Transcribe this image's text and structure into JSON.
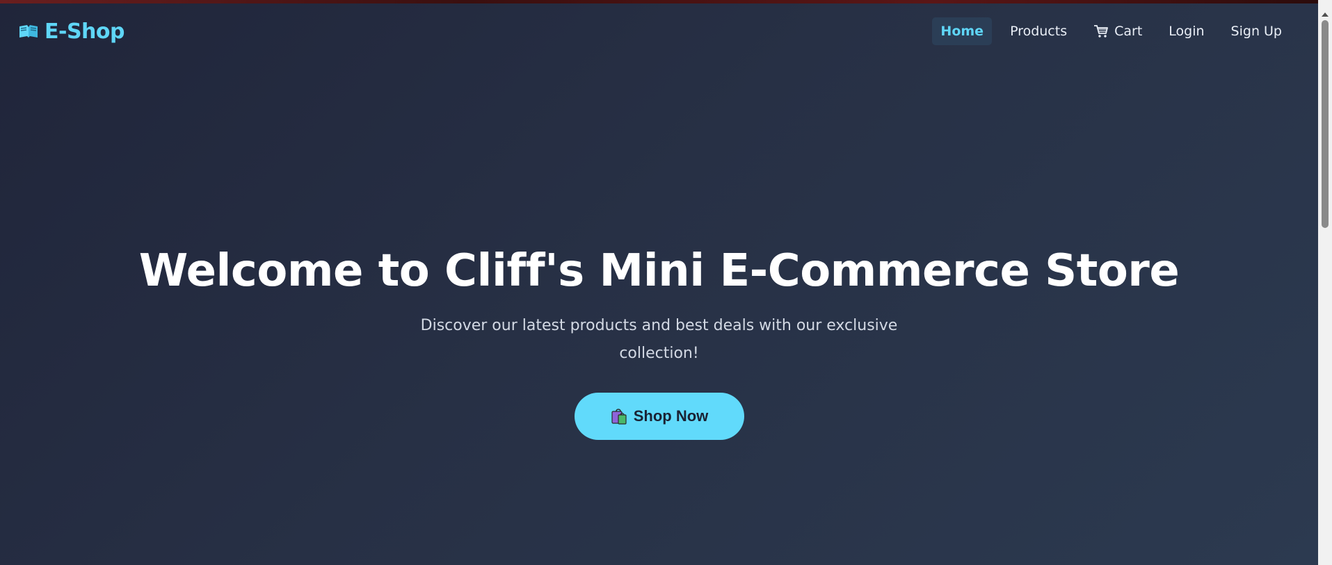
{
  "navbar": {
    "brand": {
      "icon": "books-icon",
      "label": "E-Shop"
    },
    "links": [
      {
        "label": "Home",
        "active": true
      },
      {
        "label": "Products",
        "active": false
      },
      {
        "label": "Cart",
        "icon": "shopping-cart-icon",
        "active": false
      },
      {
        "label": "Login",
        "active": false
      },
      {
        "label": "Sign Up",
        "active": false
      }
    ]
  },
  "hero": {
    "title": "Welcome to Cliff's Mini E-Commerce Store",
    "subtitle": "Discover our latest products and best deals with our exclusive collection!",
    "cta": {
      "icon": "shopping-bags-icon",
      "label": "Shop Now"
    }
  },
  "colors": {
    "accent": "#61dafb",
    "background_start": "#20253a",
    "background_end": "#2c3a50",
    "text_primary": "#ffffff",
    "text_secondary": "#d3d9e4"
  }
}
